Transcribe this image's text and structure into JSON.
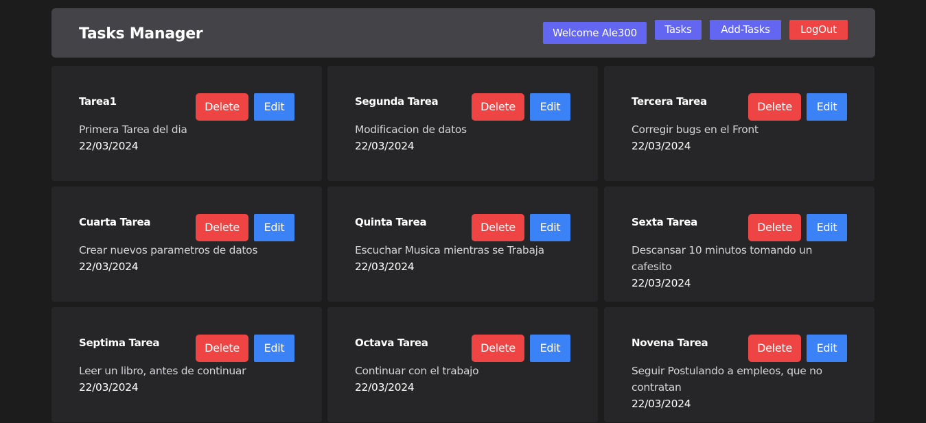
{
  "navbar": {
    "brand": "Tasks Manager",
    "welcome": "Welcome Ale300",
    "tasks": "Tasks",
    "add_tasks": "Add-Tasks",
    "logout": "LogOut"
  },
  "labels": {
    "delete": "Delete",
    "edit": "Edit"
  },
  "colors": {
    "background": "#1c1c1d",
    "navbar": "#434348",
    "card": "#262628",
    "indigo": "#6366f1",
    "red": "#ef4444",
    "blue": "#3b82f6"
  },
  "tasks": [
    {
      "title": "Tarea1",
      "description": "Primera Tarea del dia",
      "date": "22/03/2024"
    },
    {
      "title": "Segunda Tarea",
      "description": "Modificacion de datos",
      "date": "22/03/2024"
    },
    {
      "title": "Tercera Tarea",
      "description": "Corregir bugs en el Front",
      "date": "22/03/2024"
    },
    {
      "title": "Cuarta Tarea",
      "description": "Crear nuevos parametros de datos",
      "date": "22/03/2024"
    },
    {
      "title": "Quinta Tarea",
      "description": "Escuchar Musica mientras se Trabaja",
      "date": "22/03/2024"
    },
    {
      "title": "Sexta Tarea",
      "description": "Descansar 10 minutos tomando un cafesito",
      "date": "22/03/2024"
    },
    {
      "title": "Septima Tarea",
      "description": "Leer un libro, antes de continuar",
      "date": "22/03/2024"
    },
    {
      "title": "Octava Tarea",
      "description": "Continuar con el trabajo",
      "date": "22/03/2024"
    },
    {
      "title": "Novena Tarea",
      "description": "Seguir Postulando a empleos, que no contratan",
      "date": "22/03/2024"
    }
  ]
}
